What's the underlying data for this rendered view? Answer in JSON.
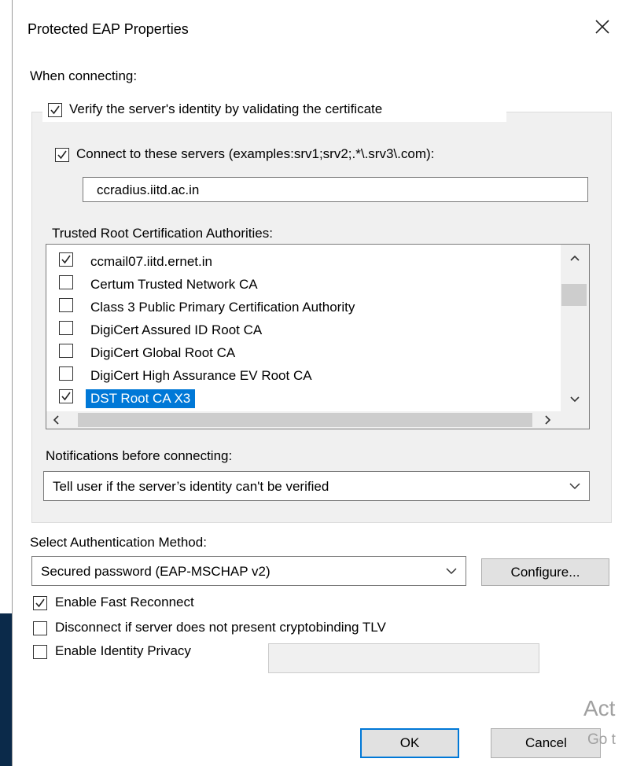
{
  "dialog": {
    "title": "Protected EAP Properties"
  },
  "connecting": {
    "heading": "When connecting:",
    "verify_identity": {
      "label": "Verify the server's identity by validating the certificate",
      "checked": true
    },
    "connect_to_servers": {
      "label": "Connect to these servers (examples:srv1;srv2;.*\\.srv3\\.com):",
      "checked": true
    },
    "servers_value": "ccradius.iitd.ac.in",
    "trusted_roots_label": "Trusted Root Certification Authorities:",
    "trusted_roots": [
      {
        "label": "ccmail07.iitd.ernet.in",
        "checked": true,
        "selected": false
      },
      {
        "label": "Certum Trusted Network CA",
        "checked": false,
        "selected": false
      },
      {
        "label": "Class 3 Public Primary Certification Authority",
        "checked": false,
        "selected": false
      },
      {
        "label": "DigiCert Assured ID Root CA",
        "checked": false,
        "selected": false
      },
      {
        "label": "DigiCert Global Root CA",
        "checked": false,
        "selected": false
      },
      {
        "label": "DigiCert High Assurance EV Root CA",
        "checked": false,
        "selected": false
      },
      {
        "label": "DST Root CA X3",
        "checked": true,
        "selected": true
      }
    ],
    "notifications_label": "Notifications before connecting:",
    "notifications_value": "Tell user if the server’s identity can't be verified"
  },
  "auth": {
    "method_label": "Select Authentication Method:",
    "method_value": "Secured password (EAP-MSCHAP v2)",
    "configure_label": "Configure...",
    "fast_reconnect": {
      "label": "Enable Fast Reconnect",
      "checked": true
    },
    "cryptobinding": {
      "label": "Disconnect if server does not present cryptobinding TLV",
      "checked": false
    },
    "identity_privacy": {
      "label": "Enable Identity Privacy",
      "checked": false
    },
    "identity_privacy_value": ""
  },
  "buttons": {
    "ok_label": "OK",
    "cancel_label": "Cancel"
  },
  "watermark": {
    "line1": "Act",
    "line2": "Go t"
  },
  "colors": {
    "selection": "#0078d7",
    "group_bg": "#f0f0f0",
    "button_bg": "#e1e1e1"
  }
}
